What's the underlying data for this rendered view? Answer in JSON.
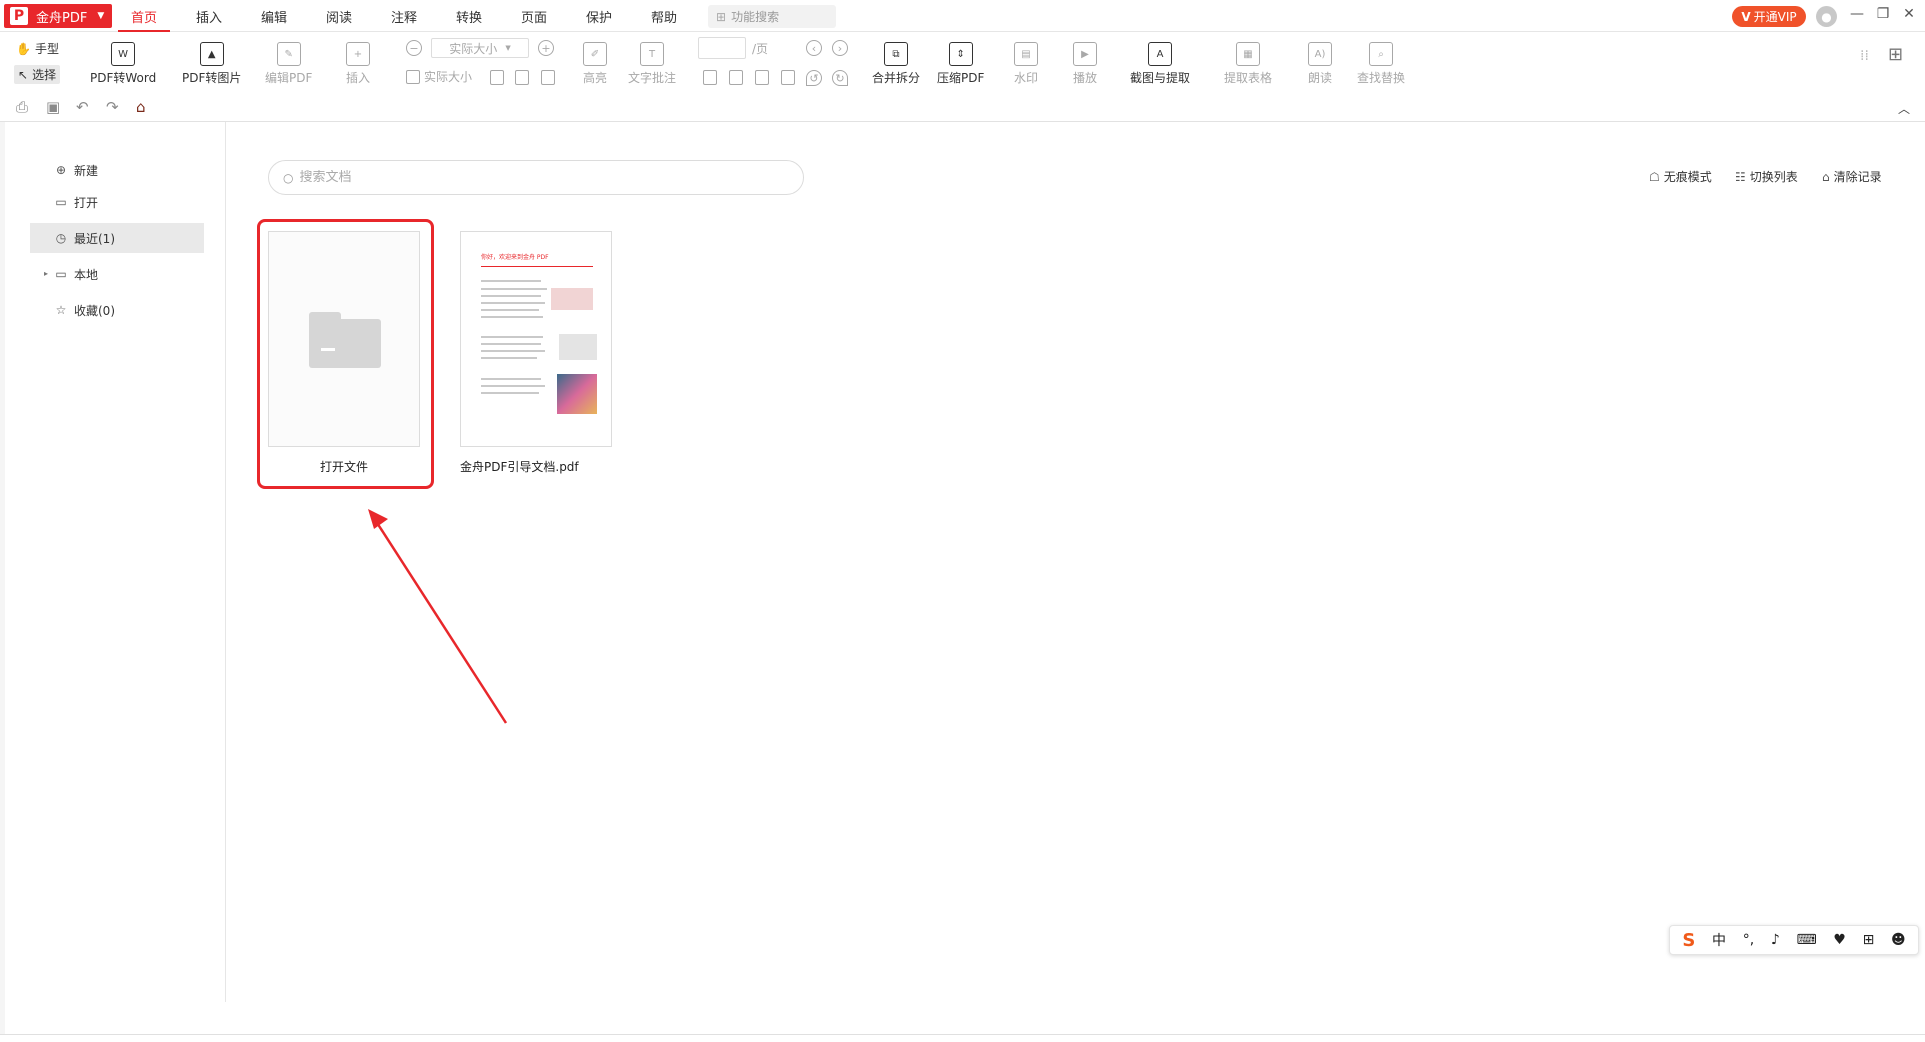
{
  "app": {
    "name": "金舟PDF",
    "logo_letter": "P",
    "brand_color": "#e8272b"
  },
  "menu": {
    "items": [
      "首页",
      "插入",
      "编辑",
      "阅读",
      "注释",
      "转换",
      "页面",
      "保护",
      "帮助"
    ],
    "active": "首页",
    "function_search_placeholder": "功能搜索"
  },
  "titlebar": {
    "vip_label": "开通VIP",
    "vip_letter": "V",
    "vip_color": "#f0522a"
  },
  "ribbon": {
    "hand_label": "手型",
    "select_label": "选择",
    "pdf_to_word": "PDF转Word",
    "pdf_to_image": "PDF转图片",
    "edit_pdf": "编辑PDF",
    "insert": "插入",
    "zoom_value": "实际大小",
    "actual_size": "实际大小",
    "page_suffix": "/页",
    "highlight": "高亮",
    "text_annotation": "文字批注",
    "merge_split": "合并拆分",
    "compress_pdf": "压缩PDF",
    "watermark": "水印",
    "playback": "播放",
    "screenshot_extract": "截图与提取",
    "extract_table": "提取表格",
    "read_aloud": "朗读",
    "find_replace": "查找替换"
  },
  "sidebar": {
    "items": [
      {
        "label": "新建",
        "icon": "new-file-icon"
      },
      {
        "label": "打开",
        "icon": "open-file-icon"
      },
      {
        "label": "最近(1)",
        "icon": "clock-icon"
      },
      {
        "label": "本地",
        "icon": "computer-icon"
      },
      {
        "label": "收藏(0)",
        "icon": "star-icon"
      }
    ],
    "active_index": 2
  },
  "main": {
    "search_placeholder": "搜索文档",
    "incognito_mode": "无痕模式",
    "switch_list": "切换列表",
    "clear_records": "清除记录",
    "files": [
      {
        "label": "打开文件",
        "type": "open-placeholder"
      },
      {
        "label": "金舟PDF引导文档.pdf",
        "type": "pdf",
        "thumbnail_title": "你好，欢迎来到金舟 PDF"
      }
    ]
  },
  "ime": {
    "language": "中"
  },
  "annotation": {
    "color": "#e8272b"
  }
}
